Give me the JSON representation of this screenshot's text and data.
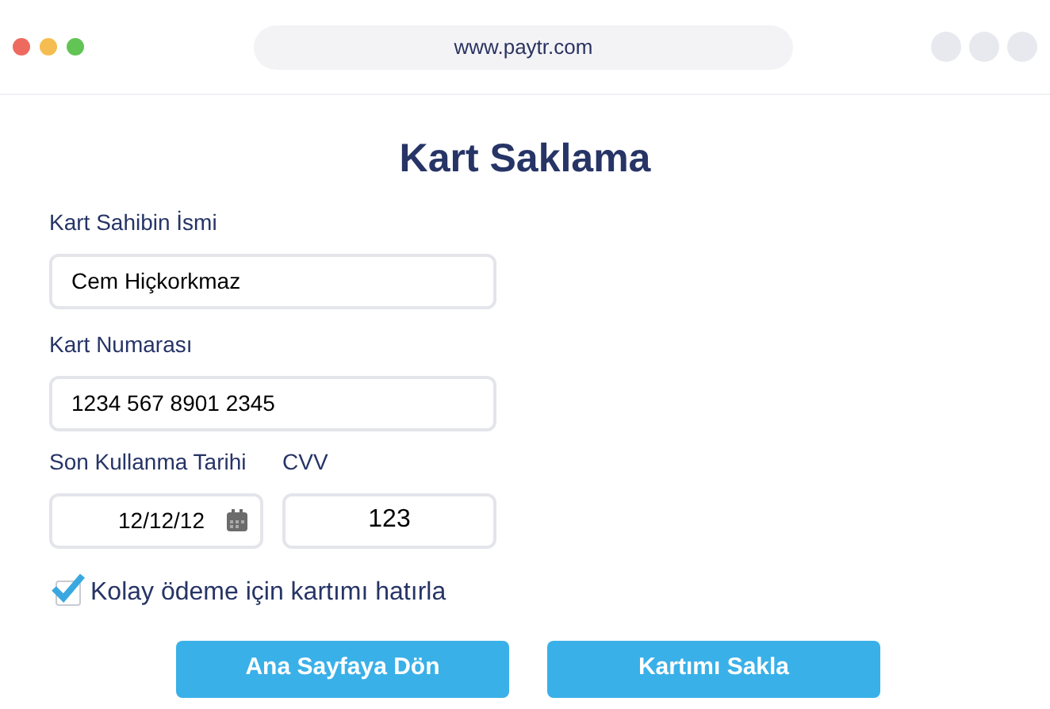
{
  "browser": {
    "url": "www.paytr.com"
  },
  "title": "Kart Saklama",
  "fields": [
    {
      "label": "Kart Sahibin İsmi",
      "value": "Cem Hiçkorkmaz"
    },
    {
      "label": "Kart Numarası",
      "value": "1234 567 8901 2345"
    }
  ],
  "expiry": {
    "label": "Son Kullanma Tarihi",
    "value": "12/12/12"
  },
  "cvv": {
    "label": "CVV",
    "value": "123"
  },
  "remember": {
    "label": "Kolay ödeme için kartımı hatırla",
    "checked": true
  },
  "buttons": [
    "Ana Sayfaya Dön",
    "Kartımı Sakla"
  ]
}
